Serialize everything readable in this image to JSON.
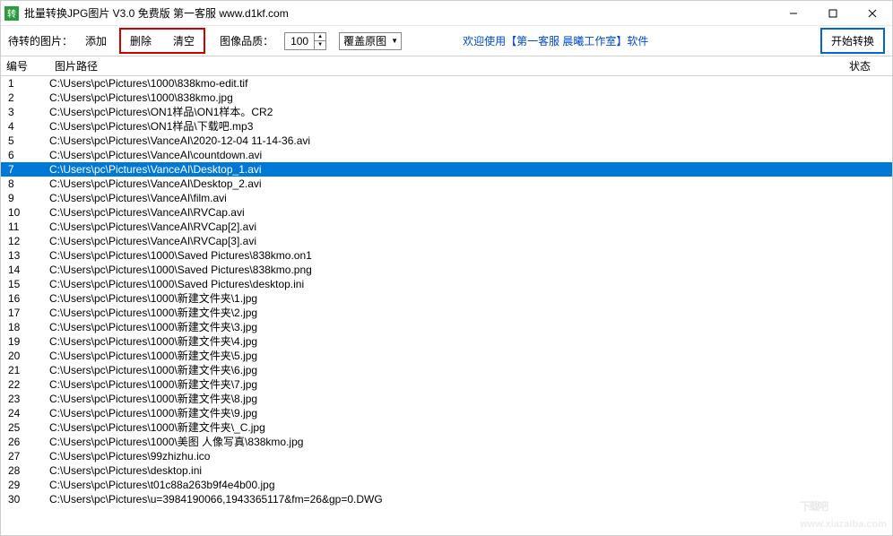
{
  "window": {
    "title": "批量转换JPG图片  V3.0 免费版      第一客服 www.d1kf.com"
  },
  "toolbar": {
    "pending_label": "待转的图片：",
    "add": "添加",
    "delete": "删除",
    "clear": "清空",
    "quality_label": "图像品质：",
    "quality_value": "100",
    "overwrite": "覆盖原图",
    "welcome": "欢迎使用【第一客服  晨曦工作室】软件",
    "start": "开始转换"
  },
  "columns": {
    "num": "编号",
    "path": "图片路径",
    "status": "状态"
  },
  "rows": [
    {
      "n": "1",
      "p": "C:\\Users\\pc\\Pictures\\1000\\838kmo-edit.tif",
      "s": ""
    },
    {
      "n": "2",
      "p": "C:\\Users\\pc\\Pictures\\1000\\838kmo.jpg",
      "s": ""
    },
    {
      "n": "3",
      "p": "C:\\Users\\pc\\Pictures\\ON1样品\\ON1样本。CR2",
      "s": ""
    },
    {
      "n": "4",
      "p": "C:\\Users\\pc\\Pictures\\ON1样品\\下载吧.mp3",
      "s": ""
    },
    {
      "n": "5",
      "p": "C:\\Users\\pc\\Pictures\\VanceAI\\2020-12-04 11-14-36.avi",
      "s": ""
    },
    {
      "n": "6",
      "p": "C:\\Users\\pc\\Pictures\\VanceAI\\countdown.avi",
      "s": ""
    },
    {
      "n": "7",
      "p": "C:\\Users\\pc\\Pictures\\VanceAI\\Desktop_1.avi",
      "s": "",
      "sel": true
    },
    {
      "n": "8",
      "p": "C:\\Users\\pc\\Pictures\\VanceAI\\Desktop_2.avi",
      "s": ""
    },
    {
      "n": "9",
      "p": "C:\\Users\\pc\\Pictures\\VanceAI\\film.avi",
      "s": ""
    },
    {
      "n": "10",
      "p": "C:\\Users\\pc\\Pictures\\VanceAI\\RVCap.avi",
      "s": ""
    },
    {
      "n": "11",
      "p": "C:\\Users\\pc\\Pictures\\VanceAI\\RVCap[2].avi",
      "s": ""
    },
    {
      "n": "12",
      "p": "C:\\Users\\pc\\Pictures\\VanceAI\\RVCap[3].avi",
      "s": ""
    },
    {
      "n": "13",
      "p": "C:\\Users\\pc\\Pictures\\1000\\Saved Pictures\\838kmo.on1",
      "s": ""
    },
    {
      "n": "14",
      "p": "C:\\Users\\pc\\Pictures\\1000\\Saved Pictures\\838kmo.png",
      "s": ""
    },
    {
      "n": "15",
      "p": "C:\\Users\\pc\\Pictures\\1000\\Saved Pictures\\desktop.ini",
      "s": ""
    },
    {
      "n": "16",
      "p": "C:\\Users\\pc\\Pictures\\1000\\新建文件夹\\1.jpg",
      "s": ""
    },
    {
      "n": "17",
      "p": "C:\\Users\\pc\\Pictures\\1000\\新建文件夹\\2.jpg",
      "s": ""
    },
    {
      "n": "18",
      "p": "C:\\Users\\pc\\Pictures\\1000\\新建文件夹\\3.jpg",
      "s": ""
    },
    {
      "n": "19",
      "p": "C:\\Users\\pc\\Pictures\\1000\\新建文件夹\\4.jpg",
      "s": ""
    },
    {
      "n": "20",
      "p": "C:\\Users\\pc\\Pictures\\1000\\新建文件夹\\5.jpg",
      "s": ""
    },
    {
      "n": "21",
      "p": "C:\\Users\\pc\\Pictures\\1000\\新建文件夹\\6.jpg",
      "s": ""
    },
    {
      "n": "22",
      "p": "C:\\Users\\pc\\Pictures\\1000\\新建文件夹\\7.jpg",
      "s": ""
    },
    {
      "n": "23",
      "p": "C:\\Users\\pc\\Pictures\\1000\\新建文件夹\\8.jpg",
      "s": ""
    },
    {
      "n": "24",
      "p": "C:\\Users\\pc\\Pictures\\1000\\新建文件夹\\9.jpg",
      "s": ""
    },
    {
      "n": "25",
      "p": "C:\\Users\\pc\\Pictures\\1000\\新建文件夹\\_C.jpg",
      "s": ""
    },
    {
      "n": "26",
      "p": "C:\\Users\\pc\\Pictures\\1000\\美图 人像写真\\838kmo.jpg",
      "s": ""
    },
    {
      "n": "27",
      "p": "C:\\Users\\pc\\Pictures\\99zhizhu.ico",
      "s": ""
    },
    {
      "n": "28",
      "p": "C:\\Users\\pc\\Pictures\\desktop.ini",
      "s": ""
    },
    {
      "n": "29",
      "p": "C:\\Users\\pc\\Pictures\\t01c88a263b9f4e4b00.jpg",
      "s": ""
    },
    {
      "n": "30",
      "p": "C:\\Users\\pc\\Pictures\\u=3984190066,1943365117&fm=26&gp=0.DWG",
      "s": ""
    }
  ],
  "watermark": {
    "big": "下载吧",
    "small": "www.xiazaiba.com"
  }
}
